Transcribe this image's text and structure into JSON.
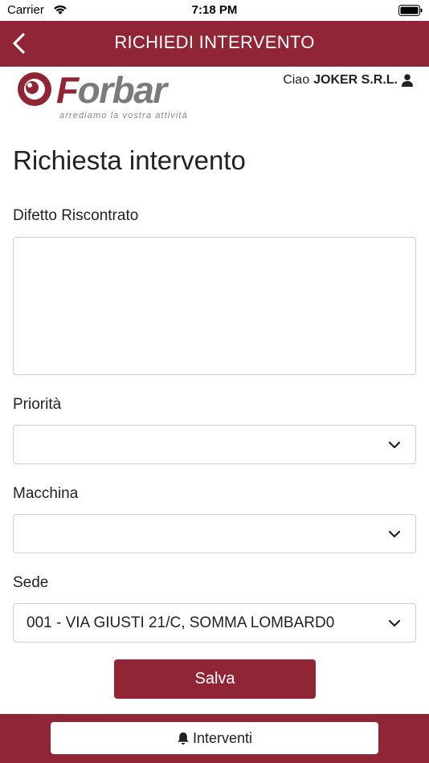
{
  "status_bar": {
    "carrier": "Carrier",
    "time": "7:18 PM",
    "icons": [
      "wifi-icon",
      "battery-icon"
    ]
  },
  "nav": {
    "title": "RICHIEDI INTERVENTO",
    "back_icon": "chevron-left-icon"
  },
  "header": {
    "logo_text_accent": "F",
    "logo_text_rest": "orbar",
    "logo_tagline": "arrediamo la vostra attività",
    "greeting_prefix": "Ciao",
    "user_name": "JOKER S.R.L.",
    "user_icon": "user-icon"
  },
  "form": {
    "title": "Richiesta intervento",
    "defect": {
      "label": "Difetto Riscontrato",
      "value": ""
    },
    "priority": {
      "label": "Priorità",
      "value": ""
    },
    "machine": {
      "label": "Macchina",
      "value": ""
    },
    "site": {
      "label": "Sede",
      "value": "001 - VIA GIUSTI 21/C, SOMMA LOMBARD0"
    },
    "save_label": "Salva"
  },
  "footer": {
    "button_label": "Interventi",
    "button_icon": "bell-icon"
  },
  "colors": {
    "brand": "#8f2535",
    "logo_grey": "#7b7b7b",
    "border": "#cfcfcf"
  }
}
